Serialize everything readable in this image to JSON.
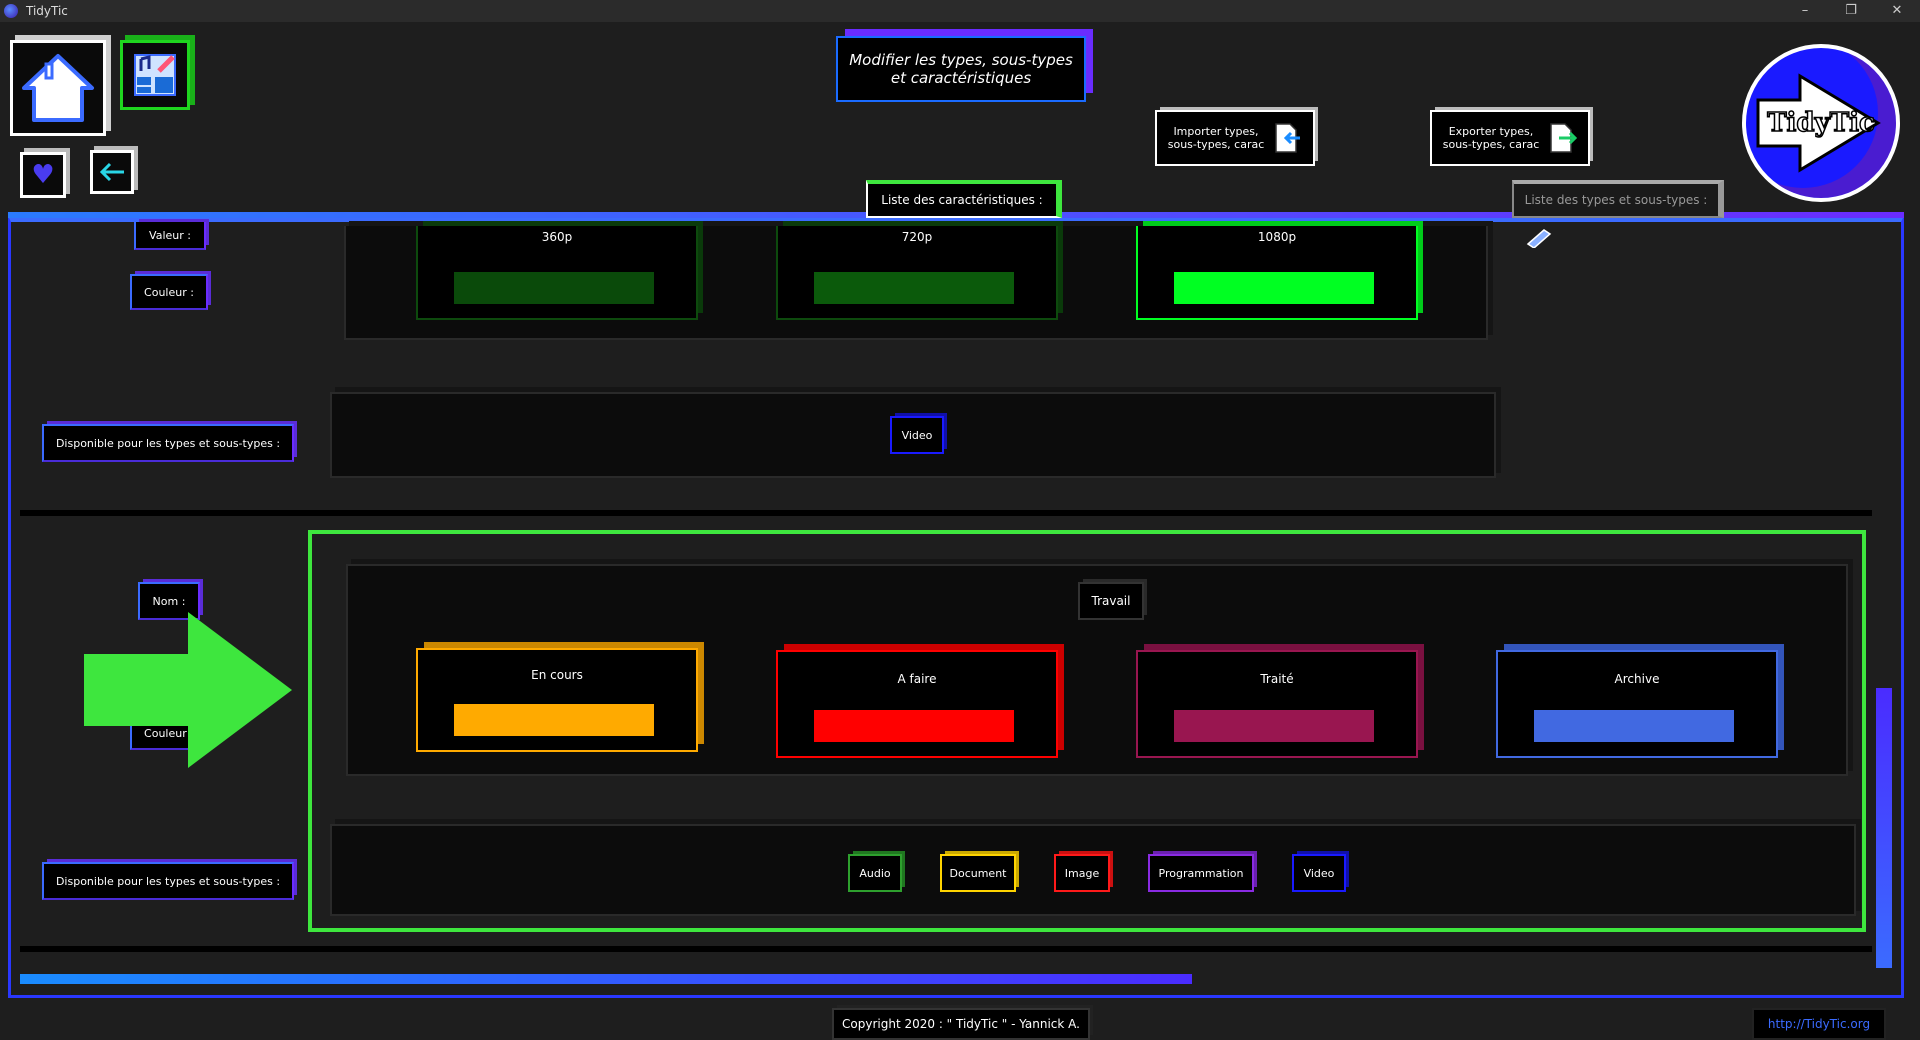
{
  "window": {
    "title": "TidyTic",
    "controls": [
      "–",
      "❐",
      "✕"
    ]
  },
  "header": {
    "title_line1": "Modifier les types, sous-types",
    "title_line2": "et caractéristiques",
    "import_line1": "Importer types,",
    "import_line2": "sous-types, carac",
    "export_line1": "Exporter types,",
    "export_line2": "sous-types, carac",
    "logo_text": "TidyTic"
  },
  "tabs": {
    "characteristics": "Liste des caractéristiques :",
    "types": "Liste des types et sous-types :"
  },
  "section1": {
    "value_label": "Valeur :",
    "color_label": "Couleur :",
    "available_label": "Disponible pour les types et sous-types :",
    "values": [
      {
        "name": "360p",
        "color": "#0a4a0a"
      },
      {
        "name": "720p",
        "color": "#0b5a0b"
      },
      {
        "name": "1080p",
        "color": "#00ff22"
      }
    ],
    "types": [
      "Video"
    ]
  },
  "section2": {
    "name_label": "Nom :",
    "color_label": "Couleur :",
    "available_label": "Disponible pour les types et sous-types :",
    "name_value": "Travail",
    "values": [
      {
        "name": "En cours",
        "color": "#ffaa00"
      },
      {
        "name": "A faire",
        "color": "#ff0000"
      },
      {
        "name": "Traité",
        "color": "#991650"
      },
      {
        "name": "Archive",
        "color": "#4169e1"
      }
    ],
    "types": [
      {
        "name": "Audio",
        "color": "#2ea02e"
      },
      {
        "name": "Document",
        "color": "#ffd400"
      },
      {
        "name": "Image",
        "color": "#ff1a1a"
      },
      {
        "name": "Programmation",
        "color": "#8a2be2"
      },
      {
        "name": "Video",
        "color": "#1a1aff"
      }
    ]
  },
  "footer": {
    "copyright": "Copyright 2020 : \" TidyTic \" - Yannick A.",
    "url": "http://TidyTic.org"
  },
  "colors": {
    "accent_blue": "#3b6bff",
    "accent_purple": "#5a2cd8",
    "highlight_green": "#3ee63e"
  }
}
